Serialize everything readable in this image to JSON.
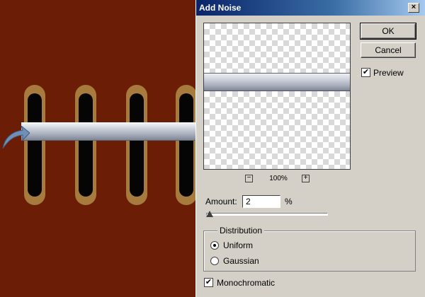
{
  "dialog": {
    "title": "Add Noise",
    "close_glyph": "×",
    "buttons": {
      "ok": "OK",
      "cancel": "Cancel"
    },
    "preview": {
      "label": "Preview",
      "checked": true
    },
    "zoom": {
      "minus_glyph": "−",
      "plus_glyph": "+",
      "level": "100%"
    },
    "amount": {
      "label": "Amount:",
      "value": "2",
      "unit": "%",
      "slider_fraction": 0.01
    },
    "distribution": {
      "title": "Distribution",
      "options": [
        {
          "label": "Uniform",
          "selected": true
        },
        {
          "label": "Gaussian",
          "selected": false
        }
      ]
    },
    "monochromatic": {
      "label": "Monochromatic",
      "checked": true
    }
  },
  "colors": {
    "canvas_background": "#6b1e05",
    "lace_hole_rim": "#a77a3e",
    "dialog_face": "#d4d0c8",
    "titlebar_start": "#0a246a"
  },
  "icons": {
    "checkmark": "✔"
  }
}
